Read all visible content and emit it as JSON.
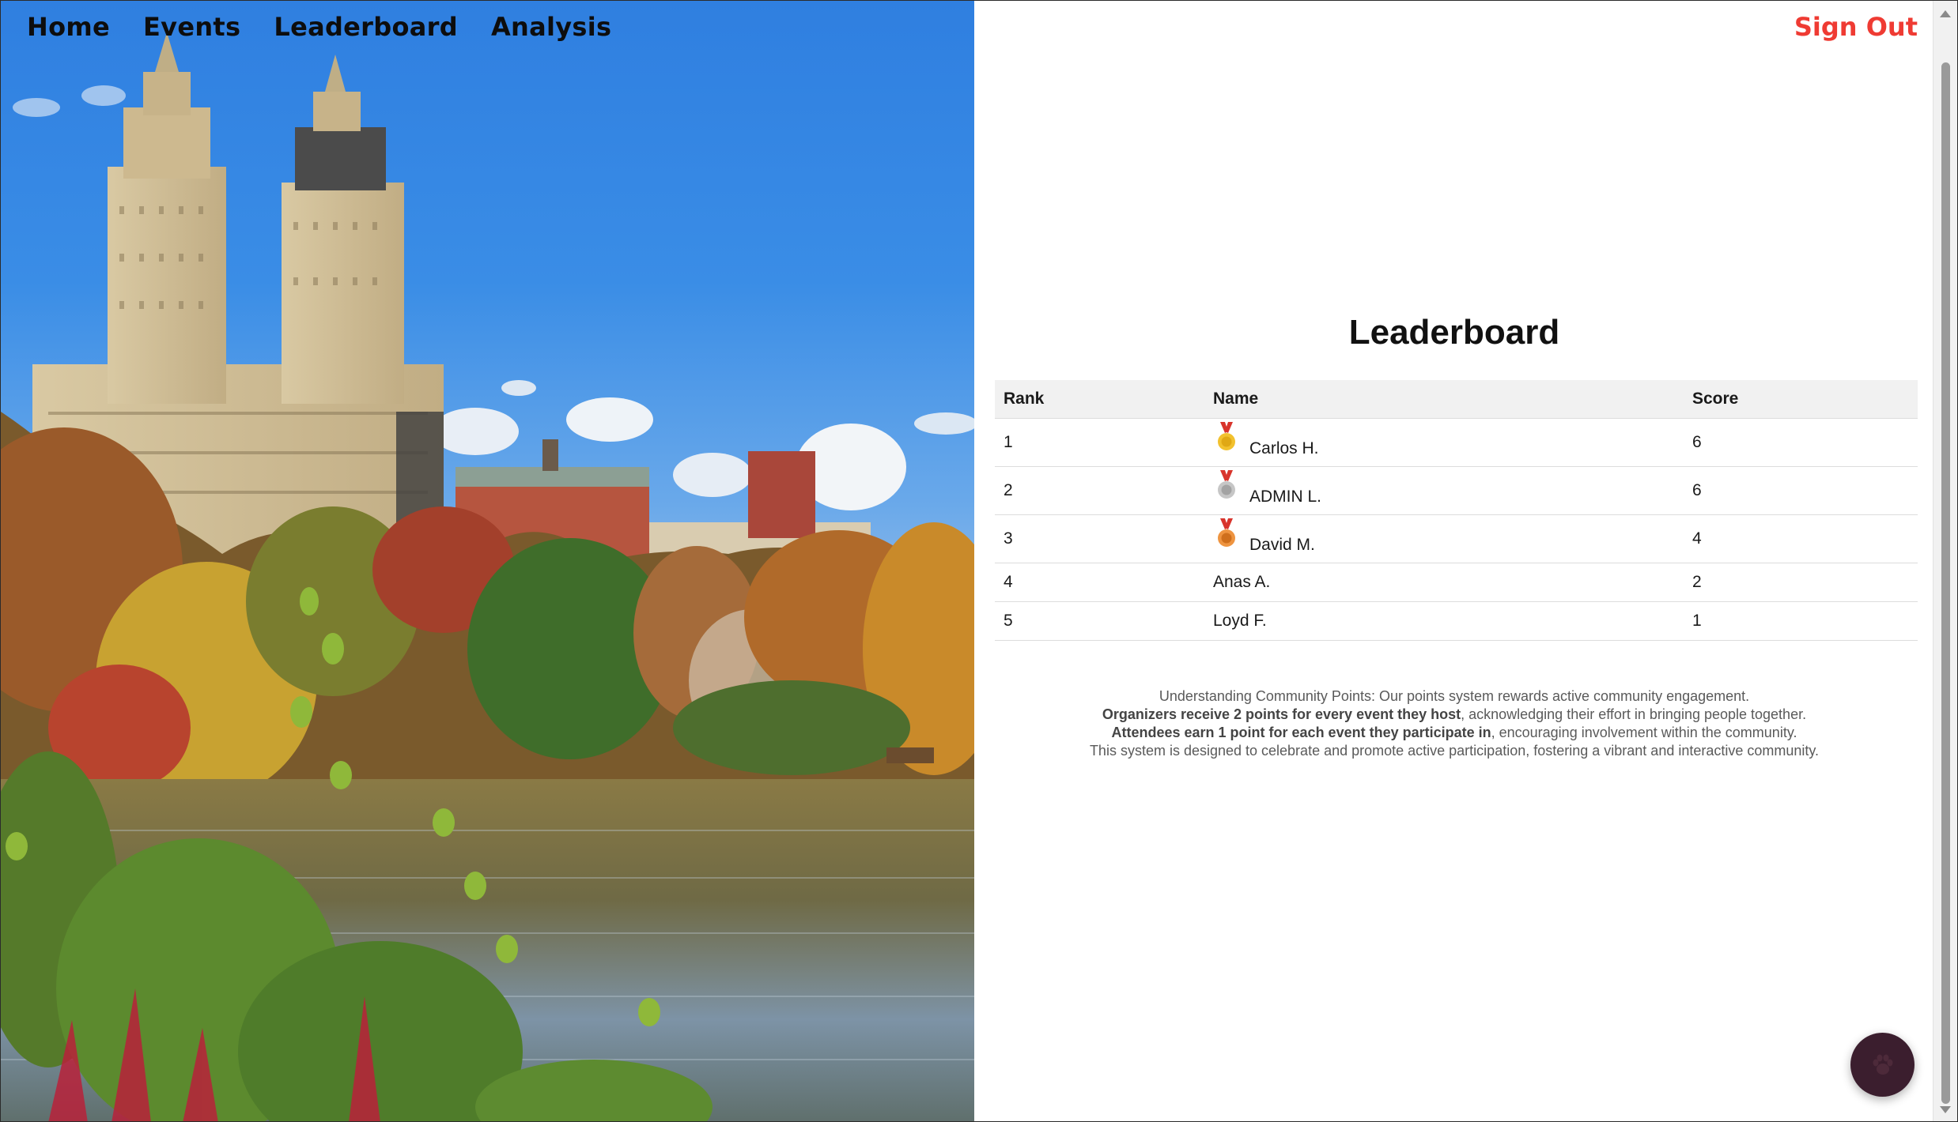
{
  "nav": {
    "items": [
      "Home",
      "Events",
      "Leaderboard",
      "Analysis"
    ],
    "sign_out": "Sign Out"
  },
  "leaderboard": {
    "title": "Leaderboard",
    "headers": {
      "rank": "Rank",
      "name": "Name",
      "score": "Score"
    },
    "rows": [
      {
        "rank": "1",
        "name": "Carlos H.",
        "score": "6",
        "medal": "gold-medal-icon"
      },
      {
        "rank": "2",
        "name": "ADMIN L.",
        "score": "6",
        "medal": "silver-medal-icon"
      },
      {
        "rank": "3",
        "name": "David M.",
        "score": "4",
        "medal": "bronze-medal-icon"
      },
      {
        "rank": "4",
        "name": "Anas A.",
        "score": "2"
      },
      {
        "rank": "5",
        "name": "Loyd F.",
        "score": "1"
      }
    ]
  },
  "points_info": {
    "line1": "Understanding Community Points: Our points system rewards active community engagement.",
    "line2_bold": "Organizers receive 2 points for every event they host",
    "line2_rest": ", acknowledging their effort in bringing people together.",
    "line3_bold": "Attendees earn 1 point for each event they participate in",
    "line3_rest": ", encouraging involvement within the community.",
    "line4": "This system is designed to celebrate and promote active participation, fostering a vibrant and interactive community."
  },
  "fab": {
    "icon": "paw-icon"
  },
  "colors": {
    "sign_out": "#ef3b33",
    "fab_bg": "#3b1e2e",
    "header_bg": "#f1f1f1",
    "gold": "#f2c12e",
    "silver": "#b9b9b9",
    "bronze": "#e8862f",
    "ribbon": "#d8342c"
  }
}
